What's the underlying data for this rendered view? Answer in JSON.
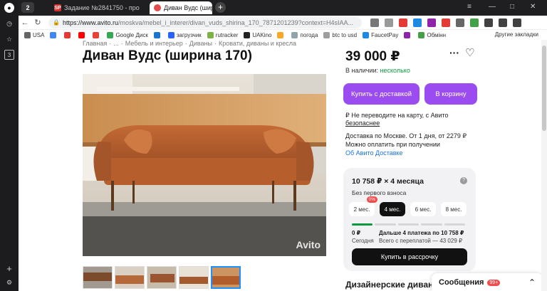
{
  "browser": {
    "tab_count": "2",
    "tabs": [
      {
        "favicon": "SP",
        "label": "Задание №2841750 - про"
      },
      {
        "favicon": "avito-icon",
        "label": "Диван Вудс (ширина 170"
      }
    ],
    "url_host": "https://www.avito.ru",
    "url_path": "/moskva/mebel_i_interer/divan_vuds_shirina_170_7871201239?context=H4sIAA...",
    "bookmarks": [
      {
        "label": "USA",
        "color": "#666666"
      },
      {
        "label": "",
        "color": "#4285f4"
      },
      {
        "label": "",
        "color": "#e53935"
      },
      {
        "label": "",
        "color": "#ff0000"
      },
      {
        "label": "",
        "color": "#ea4335"
      },
      {
        "label": "Google Диск",
        "color": "#34a853"
      },
      {
        "label": "",
        "color": "#1976d2"
      },
      {
        "label": "загрузчик",
        "color": "#2962ff"
      },
      {
        "label": "rutracker",
        "color": "#7cb342"
      },
      {
        "label": "UAKino",
        "color": "#222222"
      },
      {
        "label": "",
        "color": "#f9a825"
      },
      {
        "label": "погода",
        "color": "#90a4ae"
      },
      {
        "label": "btc to usd",
        "color": "#9e9e9e"
      },
      {
        "label": "FaucetPay",
        "color": "#1e88e5"
      },
      {
        "label": "",
        "color": "#8e24aa"
      },
      {
        "label": "Обмінн",
        "color": "#43a047"
      }
    ],
    "other_bookmarks": "Другие закладки"
  },
  "page": {
    "breadcrumbs": [
      "Главная",
      "·",
      "...",
      "·",
      "Мебель и интерьер",
      "·",
      "Диваны",
      "·",
      "Кровати, диваны и кресла"
    ],
    "title": "Диван Вудс (ширина 170)",
    "photo_watermark": "Avito",
    "price": "39 000 ₽",
    "stock_label": "В наличии:",
    "stock_value": "несколько",
    "buy_delivery": "Купить с доставкой",
    "to_cart": "В корзину",
    "warning_line1": "₽ Не переводите на карту, с Авито",
    "warning_line2": "безопаснее",
    "delivery_line1": "Доставка по Москве. От 1 дня, от 2279 ₽",
    "delivery_line2": "Можно оплатить при получении",
    "delivery_link": "Об Авито Доставке",
    "credit": {
      "heading": "10 758 ₽ × 4 месяца",
      "help": "?",
      "subtitle": "Без первого взноса",
      "terms": [
        {
          "label": "2 мес.",
          "badge": "0%",
          "selected": false
        },
        {
          "label": "4 мес.",
          "badge": "",
          "selected": true
        },
        {
          "label": "6 мес.",
          "badge": "",
          "selected": false
        },
        {
          "label": "8 мес.",
          "badge": "",
          "selected": false
        }
      ],
      "today_value": "0 ₽",
      "today_label": "Сегодня",
      "next_value": "Дальше 4 платежа по 10 758 ₽",
      "next_label": "Всего с переплатой — 43 029 ₽",
      "button": "Купить в рассрочку"
    },
    "designer_heading": "Дизайнерские диван",
    "messages_label": "Сообщения",
    "messages_count": "99+"
  },
  "colors": {
    "accent": "#9a4cf0",
    "success": "#0a9b3d",
    "badge": "#f24b4b"
  }
}
